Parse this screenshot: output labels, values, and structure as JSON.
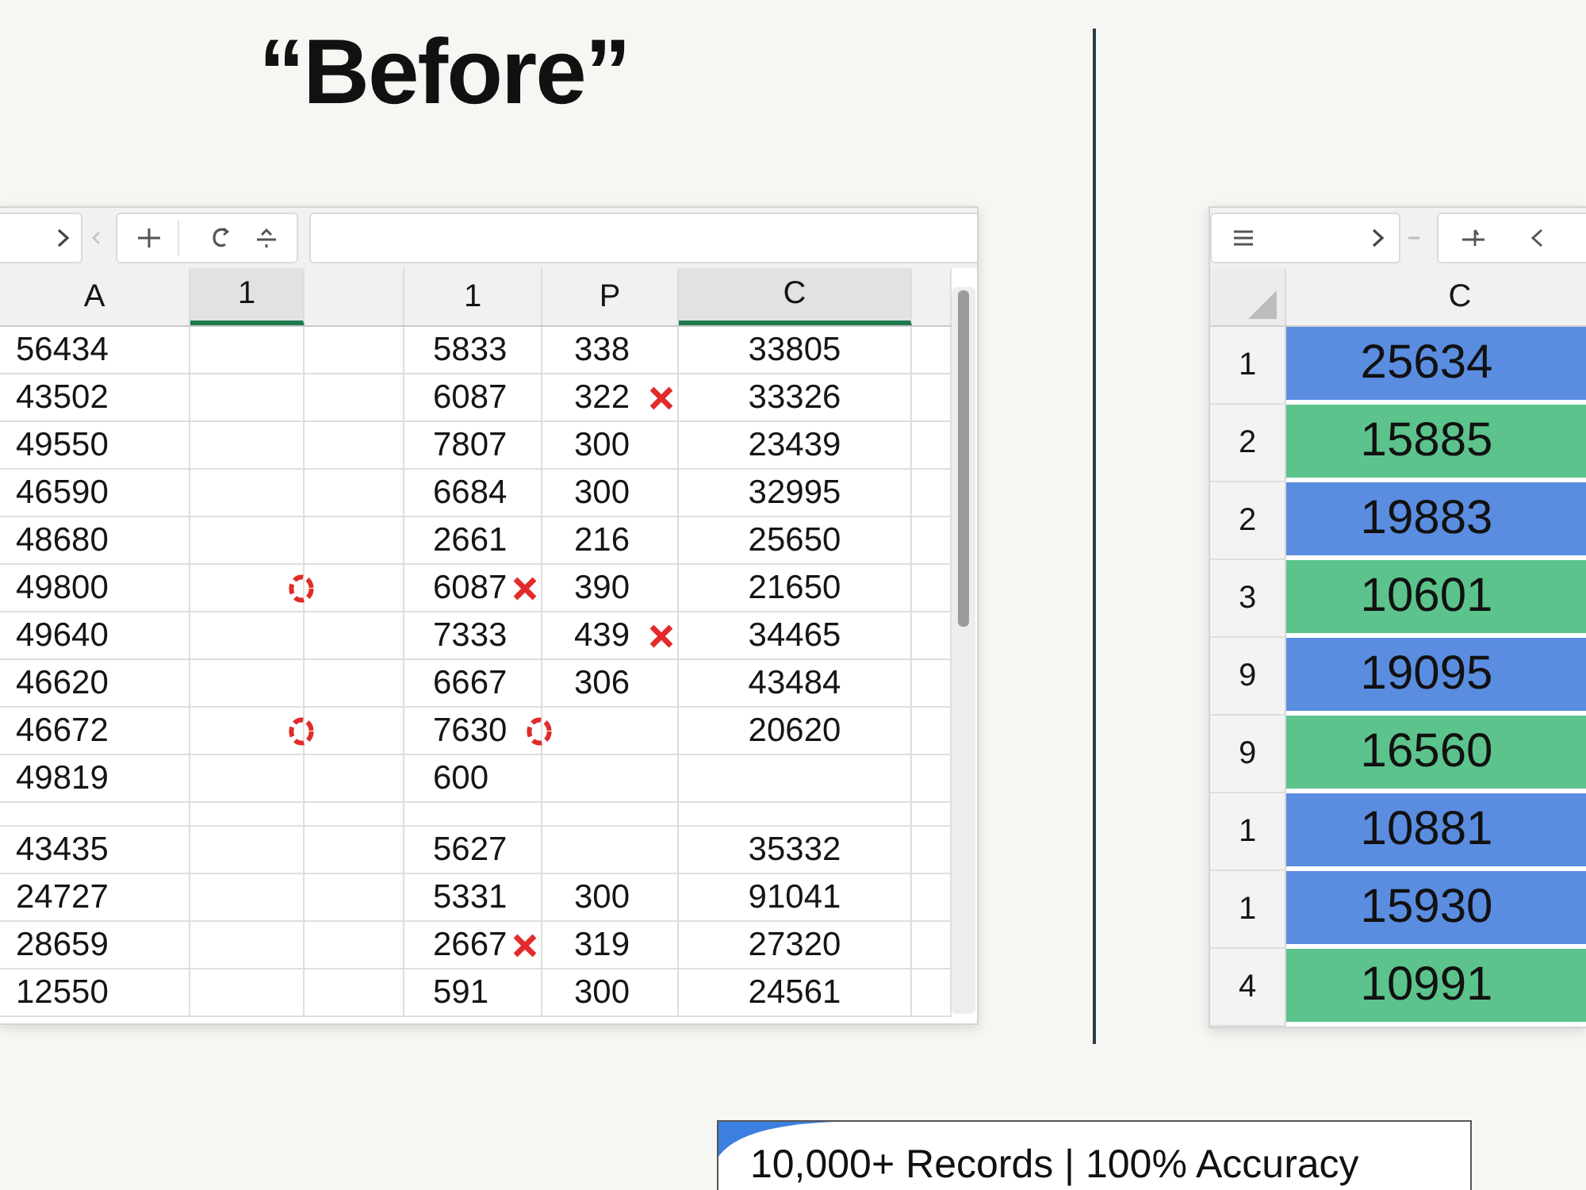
{
  "title": "“Before”",
  "before_sheet": {
    "columns": [
      {
        "label": "A",
        "selected": false
      },
      {
        "label": "1",
        "selected": true
      },
      {
        "selected": false
      },
      {
        "label": "1",
        "selected": false
      },
      {
        "label": "P",
        "selected": false
      },
      {
        "label": "C",
        "selected": true
      }
    ],
    "rows": [
      {
        "kind": "data",
        "cells": {
          "column_1": {
            "text": "56434"
          },
          "column_4": {
            "text": "5833"
          },
          "column_5": {
            "text": "338"
          },
          "column_6": {
            "text": "33805"
          }
        }
      },
      {
        "kind": "data",
        "cells": {
          "column_1": {
            "text": "43502"
          },
          "column_4": {
            "text": "6087"
          },
          "column_5": {
            "text": "322",
            "mark": {
              "kind": "cross"
            }
          },
          "column_6": {
            "text": "33326"
          }
        }
      },
      {
        "kind": "data",
        "cells": {
          "column_1": {
            "text": "49550"
          },
          "column_4": {
            "text": "7807"
          },
          "column_5": {
            "text": "300"
          },
          "column_6": {
            "text": "23439"
          }
        }
      },
      {
        "kind": "data",
        "cells": {
          "column_1": {
            "text": "46590"
          },
          "column_4": {
            "text": "6684"
          },
          "column_5": {
            "text": "300"
          },
          "column_6": {
            "text": "32995"
          }
        }
      },
      {
        "kind": "data",
        "cells": {
          "column_1": {
            "text": "48680"
          },
          "column_4": {
            "text": "2661"
          },
          "column_5": {
            "text": "216"
          },
          "column_6": {
            "text": "25650"
          }
        }
      },
      {
        "kind": "data",
        "cells": {
          "column_1": {
            "text": "49800"
          },
          "column_2": {
            "mark": {
              "kind": "dashed-circle"
            }
          },
          "column_4": {
            "text": "6087",
            "mark": {
              "kind": "cross"
            }
          },
          "column_5": {
            "text": "390"
          },
          "column_6": {
            "text": "21650"
          }
        }
      },
      {
        "kind": "data",
        "cells": {
          "column_1": {
            "text": "49640"
          },
          "column_4": {
            "text": "7333"
          },
          "column_5": {
            "text": "439",
            "mark": {
              "kind": "cross"
            }
          },
          "column_6": {
            "text": "34465"
          }
        }
      },
      {
        "kind": "data",
        "cells": {
          "column_1": {
            "text": "46620"
          },
          "column_4": {
            "text": "6667"
          },
          "column_5": {
            "text": "306"
          },
          "column_6": {
            "text": "43484"
          }
        }
      },
      {
        "kind": "data",
        "cells": {
          "column_1": {
            "text": "46672"
          },
          "column_2": {
            "mark": {
              "kind": "dashed-circle"
            }
          },
          "column_4": {
            "text": "7630",
            "mark": {
              "kind": "dashed-circle"
            }
          },
          "column_6": {
            "text": "20620"
          }
        }
      },
      {
        "kind": "data",
        "cells": {
          "column_1": {
            "text": "49819"
          },
          "column_4": {
            "text": "600"
          }
        }
      },
      {
        "kind": "spacer"
      },
      {
        "kind": "data",
        "cells": {
          "column_1": {
            "text": "43435"
          },
          "column_4": {
            "text": "5627"
          },
          "column_6": {
            "text": "35332"
          }
        }
      },
      {
        "kind": "data",
        "cells": {
          "column_1": {
            "text": "24727"
          },
          "column_4": {
            "text": "5331"
          },
          "column_5": {
            "text": "300"
          },
          "column_6": {
            "text": "91041"
          }
        }
      },
      {
        "kind": "data",
        "cells": {
          "column_1": {
            "text": "28659"
          },
          "column_4": {
            "text": "2667",
            "mark": {
              "kind": "cross"
            }
          },
          "column_5": {
            "text": "319"
          },
          "column_6": {
            "text": "27320"
          }
        }
      },
      {
        "kind": "data",
        "cells": {
          "column_1": {
            "text": "12550"
          },
          "column_4": {
            "text": "591"
          },
          "column_5": {
            "text": "300"
          },
          "column_6": {
            "text": "24561"
          }
        }
      }
    ]
  },
  "after_sheet": {
    "column": {
      "label": "C"
    },
    "rows": [
      {
        "number": "1",
        "value": "25634",
        "color": "#5a8de0"
      },
      {
        "number": "2",
        "value": "15885",
        "color": "#5cc38c"
      },
      {
        "number": "2",
        "value": "19883",
        "color": "#5a8de0"
      },
      {
        "number": "3",
        "value": "10601",
        "color": "#5cc38c"
      },
      {
        "number": "9",
        "value": "19095",
        "color": "#5a8de0"
      },
      {
        "number": "9",
        "value": "16560",
        "color": "#5cc38c"
      },
      {
        "number": "1",
        "value": "10881",
        "color": "#5a8de0"
      },
      {
        "number": "1",
        "value": "15930",
        "color": "#5a8de0"
      },
      {
        "number": "4",
        "value": "10991",
        "color": "#5cc38c"
      }
    ]
  },
  "banner": "10,000+ Records | 100% Accuracy"
}
